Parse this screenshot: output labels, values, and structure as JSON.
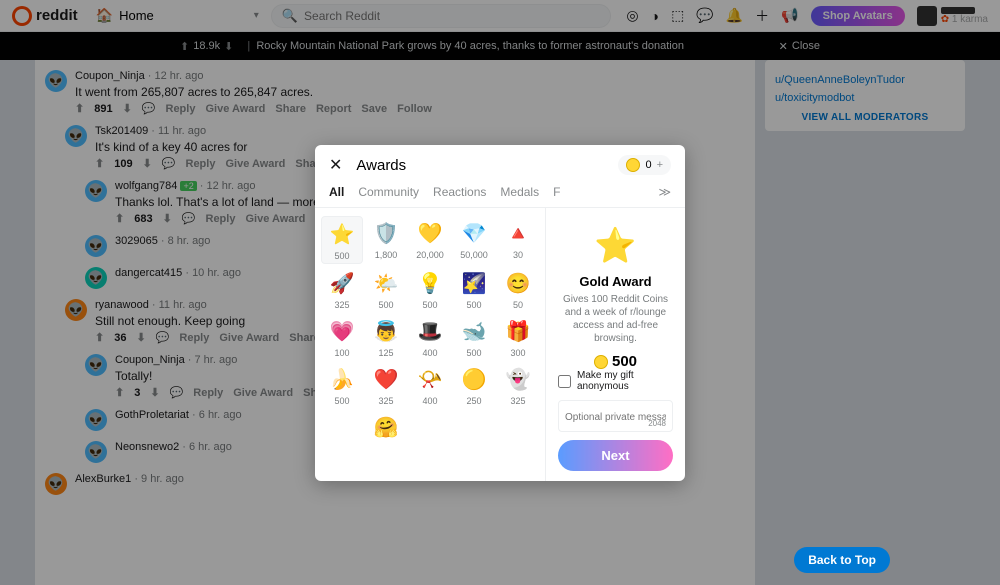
{
  "header": {
    "logo_text": "reddit",
    "home_label": "Home",
    "search_placeholder": "Search Reddit",
    "shop_label": "Shop Avatars",
    "karma_label": "1 karma"
  },
  "postbar": {
    "score": "18.9k",
    "title": "Rocky Mountain National Park grows by 40 acres, thanks to former astronaut's donation",
    "close_label": "Close"
  },
  "sidebar": {
    "mods": [
      "u/QueenAnneBoleynTudor",
      "u/toxicitymodbot"
    ],
    "viewall": "VIEW ALL MODERATORS"
  },
  "comments": [
    {
      "depth": 0,
      "user": "Coupon_Ninja",
      "time": "12 hr. ago",
      "text": "It went from 265,807 acres to 265,847 acres.",
      "score": "891",
      "av": "av-blue"
    },
    {
      "depth": 1,
      "user": "Tsk201409",
      "time": "11 hr. ago",
      "text": "It's kind of a key 40 acres for",
      "score": "109",
      "av": "av-blue"
    },
    {
      "depth": 2,
      "user": "wolfgang784",
      "time": "12 hr. ago",
      "badge": "+2",
      "text": "Thanks lol. That's a lot of land — more protected land is more",
      "score": "683",
      "av": "av-blue"
    },
    {
      "depth": 2,
      "user": "3029065",
      "time": "8 hr. ago",
      "text": "",
      "score": "",
      "av": "av-blue"
    },
    {
      "depth": 2,
      "user": "dangercat415",
      "time": "10 hr. ago",
      "text": "",
      "score": "",
      "av": "av-teal"
    },
    {
      "depth": 1,
      "user": "ryanawood",
      "time": "11 hr. ago",
      "text": "Still not enough. Keep going",
      "score": "36",
      "av": "av-orange"
    },
    {
      "depth": 2,
      "user": "Coupon_Ninja",
      "time": "7 hr. ago",
      "text": "Totally!",
      "score": "3",
      "av": "av-blue"
    },
    {
      "depth": 2,
      "user": "GothProletariat",
      "time": "6 hr. ago",
      "text": "",
      "score": "",
      "av": "av-blue"
    },
    {
      "depth": 2,
      "user": "Neonsnewo2",
      "time": "6 hr. ago",
      "text": "",
      "score": "",
      "av": "av-blue"
    },
    {
      "depth": 0,
      "user": "AlexBurke1",
      "time": "9 hr. ago",
      "text": "",
      "score": "",
      "av": "av-orange"
    }
  ],
  "action_labels": {
    "reply": "Reply",
    "give": "Give Award",
    "share": "Share",
    "report": "Report",
    "save": "Save",
    "follow": "Follow"
  },
  "modal": {
    "title": "Awards",
    "coin_balance": "0",
    "tabs": [
      "All",
      "Community",
      "Reactions",
      "Medals",
      "F"
    ],
    "selected_award": {
      "name": "Gold Award",
      "desc": "Gives 100 Reddit Coins and a week of r/lounge access and ad-free browsing.",
      "cost": "500"
    },
    "anon_label": "Make my gift anonymous",
    "msg_placeholder": "Optional private message",
    "msg_limit": "2048",
    "next_label": "Next",
    "awards": [
      {
        "emoji": "⭐",
        "price": "500",
        "bg": "#ffd635"
      },
      {
        "emoji": "🛡️",
        "price": "1,800",
        "bg": ""
      },
      {
        "emoji": "💛",
        "price": "20,000",
        "bg": ""
      },
      {
        "emoji": "💎",
        "price": "50,000",
        "bg": ""
      },
      {
        "emoji": "🔺",
        "price": "30",
        "bg": ""
      },
      {
        "emoji": "🚀",
        "price": "325",
        "bg": ""
      },
      {
        "emoji": "🌤️",
        "price": "500",
        "bg": ""
      },
      {
        "emoji": "💡",
        "price": "500",
        "bg": ""
      },
      {
        "emoji": "🌠",
        "price": "500",
        "bg": ""
      },
      {
        "emoji": "😊",
        "price": "50",
        "bg": ""
      },
      {
        "emoji": "💗",
        "price": "100",
        "bg": ""
      },
      {
        "emoji": "👼",
        "price": "125",
        "bg": ""
      },
      {
        "emoji": "🎩",
        "price": "400",
        "bg": ""
      },
      {
        "emoji": "🐋",
        "price": "500",
        "bg": ""
      },
      {
        "emoji": "🎁",
        "price": "300",
        "bg": ""
      },
      {
        "emoji": "🍌",
        "price": "500",
        "bg": ""
      },
      {
        "emoji": "❤️",
        "price": "325",
        "bg": ""
      },
      {
        "emoji": "📯",
        "price": "400",
        "bg": ""
      },
      {
        "emoji": "🟡",
        "price": "250",
        "bg": ""
      },
      {
        "emoji": "👻",
        "price": "325",
        "bg": ""
      },
      {
        "emoji": "",
        "price": "",
        "bg": ""
      },
      {
        "emoji": "🤗",
        "price": "",
        "bg": ""
      }
    ]
  },
  "back_top": "Back to Top"
}
